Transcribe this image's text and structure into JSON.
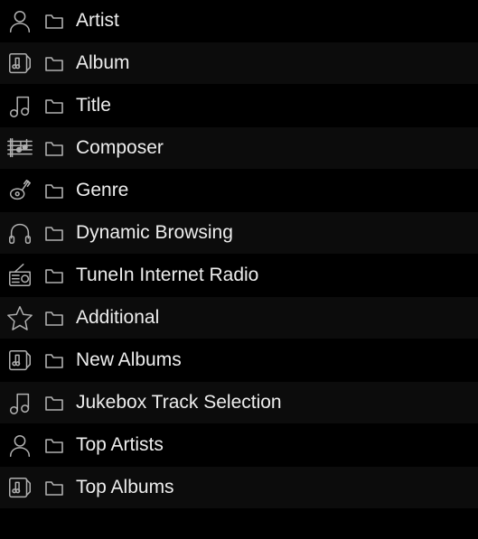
{
  "menu": {
    "items": [
      {
        "icon": "artist",
        "label": "Artist"
      },
      {
        "icon": "album",
        "label": "Album"
      },
      {
        "icon": "title",
        "label": "Title"
      },
      {
        "icon": "composer",
        "label": "Composer"
      },
      {
        "icon": "genre",
        "label": "Genre"
      },
      {
        "icon": "headphones",
        "label": "Dynamic Browsing"
      },
      {
        "icon": "radio",
        "label": "TuneIn Internet Radio"
      },
      {
        "icon": "star",
        "label": "Additional"
      },
      {
        "icon": "album",
        "label": "New Albums"
      },
      {
        "icon": "title",
        "label": "Jukebox Track Selection"
      },
      {
        "icon": "artist",
        "label": "Top Artists"
      },
      {
        "icon": "album",
        "label": "Top Albums"
      }
    ]
  }
}
